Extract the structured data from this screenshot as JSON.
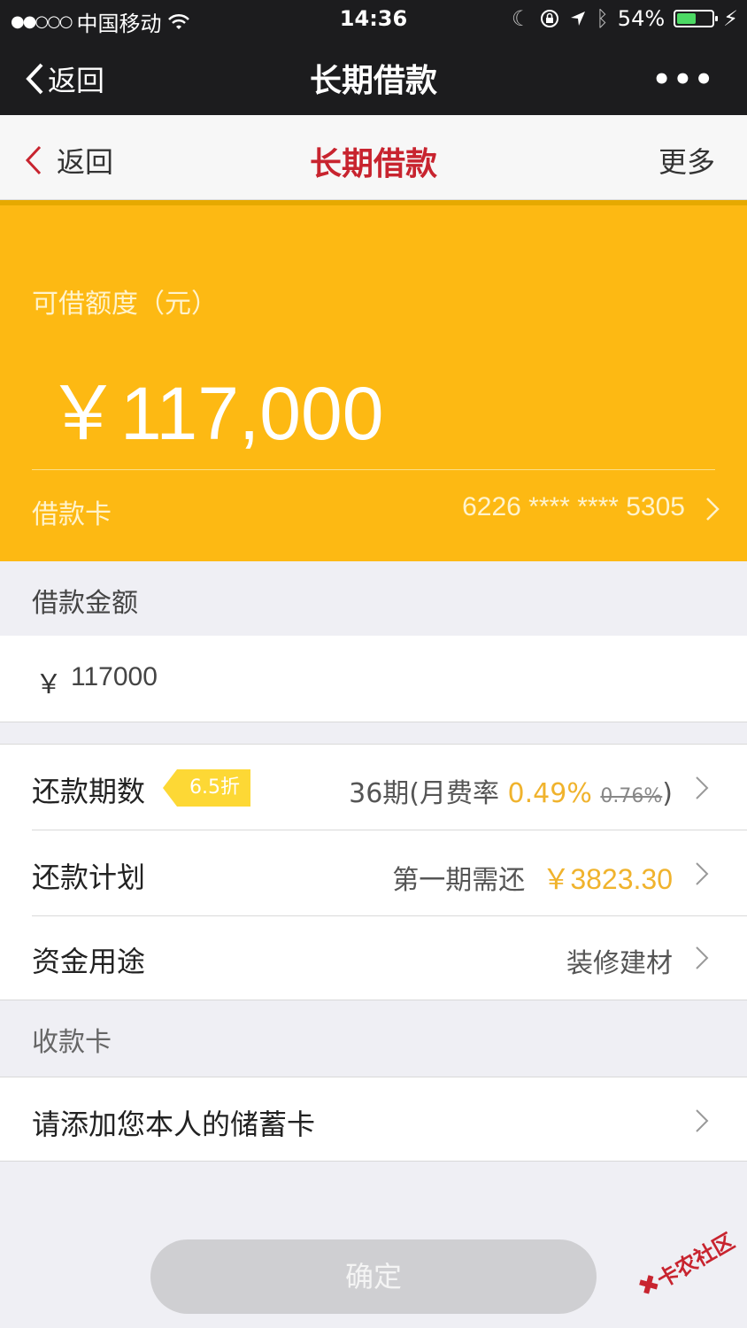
{
  "status_bar": {
    "signal": "●●○○○",
    "carrier": "中国移动",
    "time": "14:36",
    "battery_text": "54%",
    "battery_level": 0.54
  },
  "wx_nav": {
    "back_label": "返回",
    "title": "长期借款",
    "more": "•••"
  },
  "header": {
    "back_label": "返回",
    "title": "长期借款",
    "more_label": "更多"
  },
  "card": {
    "label": "可借额度（元）",
    "amount": "￥117,000",
    "card_label": "借款卡",
    "card_number": "6226 **** **** 5305"
  },
  "loan_amount": {
    "section_label": "借款金额",
    "currency": "￥",
    "value": "117000"
  },
  "terms": {
    "label": "还款期数",
    "badge": "6.5折",
    "value_prefix": "36期(月费率 ",
    "rate": "0.49%",
    "old_rate": "0.76%",
    "value_suffix": ")"
  },
  "plan": {
    "label": "还款计划",
    "value_prefix": "第一期需还",
    "amount": "￥3823.30"
  },
  "purpose": {
    "label": "资金用途",
    "value": "装修建材"
  },
  "receive_card": {
    "section_label": "收款卡",
    "placeholder": "请添加您本人的储蓄卡"
  },
  "confirm_label": "确定",
  "watermark": "卡农社区",
  "colors": {
    "card_bg": "#fdb913",
    "header_title": "#c8242f",
    "accent": "#f0b32d"
  }
}
